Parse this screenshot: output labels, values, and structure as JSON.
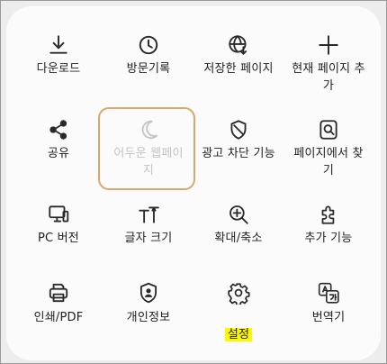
{
  "menu": {
    "items": [
      {
        "label": "다운로드",
        "icon": "download-icon"
      },
      {
        "label": "방문기록",
        "icon": "history-icon"
      },
      {
        "label": "저장한 페이지",
        "icon": "saved-pages-icon"
      },
      {
        "label": "현재 페이지 추\n가",
        "icon": "add-icon"
      },
      {
        "label": "공유",
        "icon": "share-icon"
      },
      {
        "label": "어두운 웹페이\n지",
        "icon": "moon-icon",
        "disabled": true
      },
      {
        "label": "광고 차단 기능",
        "icon": "ad-block-shield-icon"
      },
      {
        "label": "페이지에서 찾\n기",
        "icon": "find-in-page-icon"
      },
      {
        "label": "PC 버전",
        "icon": "desktop-icon"
      },
      {
        "label": "글자 크기",
        "icon": "text-size-icon"
      },
      {
        "label": "확대/축소",
        "icon": "zoom-in-icon"
      },
      {
        "label": "추가 기능",
        "icon": "extension-puzzle-icon"
      },
      {
        "label": "인쇄/PDF",
        "icon": "print-icon"
      },
      {
        "label": "개인정보",
        "icon": "privacy-icon"
      },
      {
        "label": "설정",
        "icon": "gear-icon",
        "highlighted": true
      },
      {
        "label": "번역기",
        "icon": "translate-icon"
      }
    ]
  },
  "colors": {
    "text": "#1f1f1f",
    "disabled_text": "#c4c4c4",
    "highlight": "#fff700",
    "annotation_border": "#d9a86c",
    "panel": "#fbfbfb"
  }
}
